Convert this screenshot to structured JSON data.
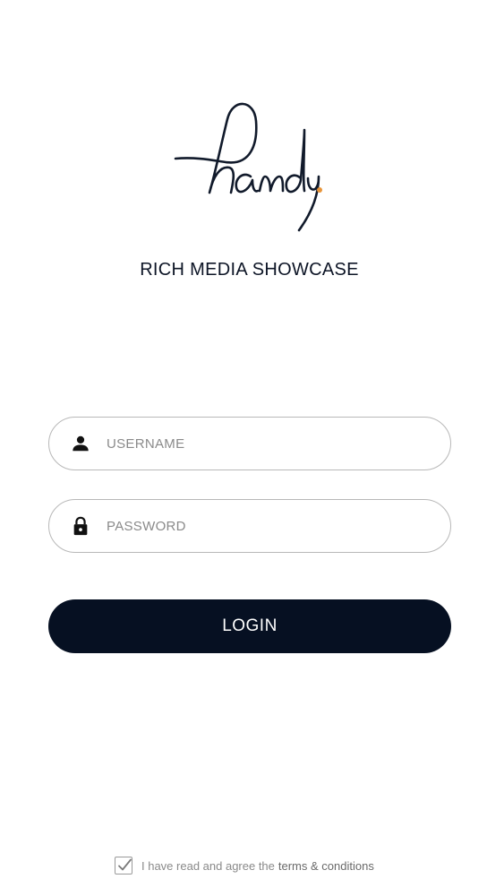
{
  "app": {
    "logo_text": "handy.",
    "logo_dot_color": "#e8953a",
    "subtitle": "RICH MEDIA SHOWCASE"
  },
  "form": {
    "username": {
      "placeholder": "USERNAME",
      "value": "",
      "icon": "person-icon"
    },
    "password": {
      "placeholder": "PASSWORD",
      "value": "",
      "icon": "lock-icon"
    },
    "login_label": "LOGIN"
  },
  "terms": {
    "checked": true,
    "prefix": "I have read and agree  the",
    "link": "terms & conditions"
  },
  "colors": {
    "primary_dark": "#061022",
    "border": "#b8b8b8",
    "placeholder": "#8a8a8a"
  }
}
